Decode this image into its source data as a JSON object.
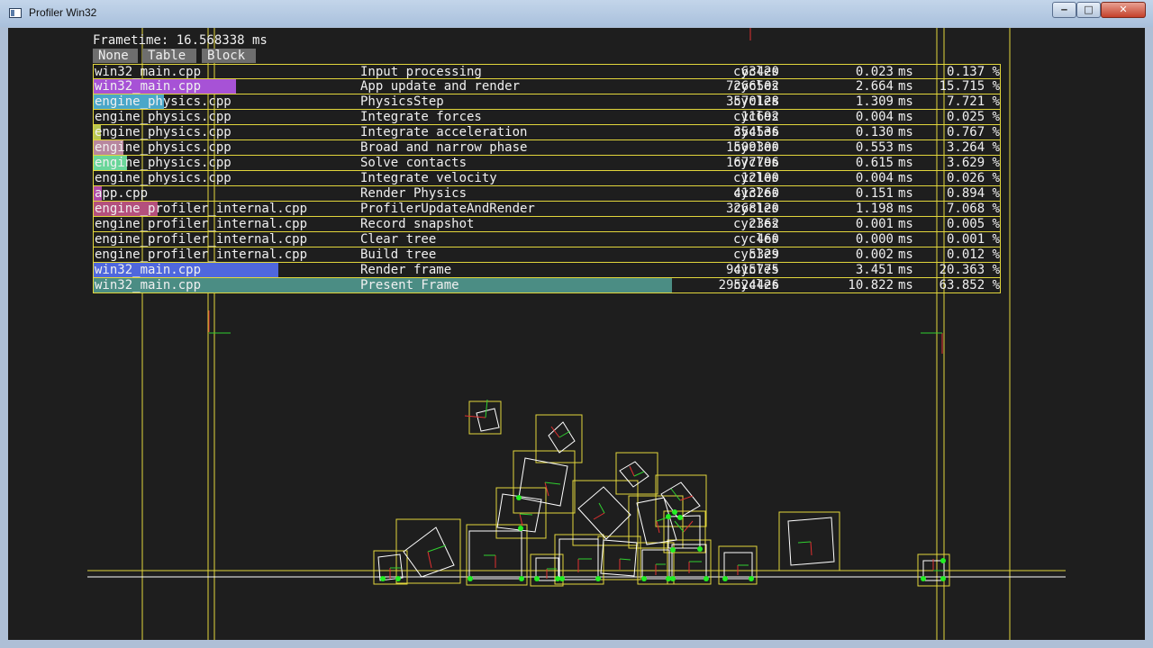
{
  "window": {
    "title": "Profiler Win32",
    "minimize_glyph": "‒",
    "maximize_glyph": "□",
    "close_glyph": "✕"
  },
  "profiler": {
    "frametime": "Frametime: 16.568338 ms",
    "modes": [
      "None",
      "Table",
      "Block"
    ],
    "rows": [
      {
        "file": "win32_main.cpp",
        "name": "Input processing",
        "cycles": "63420",
        "unit": "cycles",
        "ms": "0.023",
        "ms_unit": "ms",
        "percent": "0.137 %",
        "fraction": 0.00137,
        "color": ""
      },
      {
        "file": "win32_main.cpp",
        "name": "App update and render",
        "cycles": "7266502",
        "unit": "cycles",
        "ms": "2.664",
        "ms_unit": "ms",
        "percent": "15.715 %",
        "fraction": 0.15715,
        "color": "#a752d6"
      },
      {
        "file": "engine_physics.cpp",
        "name": "PhysicsStep",
        "cycles": "3570128",
        "unit": "cycles",
        "ms": "1.309",
        "ms_unit": "ms",
        "percent": "7.721 %",
        "fraction": 0.07721,
        "color": "#4aa7c9"
      },
      {
        "file": "engine_physics.cpp",
        "name": "Integrate forces",
        "cycles": "11692",
        "unit": "cycles",
        "ms": "0.004",
        "ms_unit": "ms",
        "percent": "0.025 %",
        "fraction": 0.00025,
        "color": ""
      },
      {
        "file": "engine_physics.cpp",
        "name": "Integrate acceleration",
        "cycles": "354536",
        "unit": "cycles",
        "ms": "0.130",
        "ms_unit": "ms",
        "percent": "0.767 %",
        "fraction": 0.00767,
        "color": "#b9c752"
      },
      {
        "file": "engine_physics.cpp",
        "name": "Broad and narrow phase",
        "cycles": "1509300",
        "unit": "cycles",
        "ms": "0.553",
        "ms_unit": "ms",
        "percent": "3.264 %",
        "fraction": 0.03264,
        "color": "#b8879f"
      },
      {
        "file": "engine_physics.cpp",
        "name": "Solve contacts",
        "cycles": "1677796",
        "unit": "cycles",
        "ms": "0.615",
        "ms_unit": "ms",
        "percent": "3.629 %",
        "fraction": 0.03629,
        "color": "#6ad69a"
      },
      {
        "file": "engine_physics.cpp",
        "name": "Integrate velocity",
        "cycles": "12100",
        "unit": "cycles",
        "ms": "0.004",
        "ms_unit": "ms",
        "percent": "0.026 %",
        "fraction": 0.00026,
        "color": ""
      },
      {
        "file": "app.cpp",
        "name": "Render Physics",
        "cycles": "413260",
        "unit": "cycles",
        "ms": "0.151",
        "ms_unit": "ms",
        "percent": "0.894 %",
        "fraction": 0.00894,
        "color": "#b04aa6"
      },
      {
        "file": "engine_profiler_internal.cpp",
        "name": "ProfilerUpdateAndRender",
        "cycles": "3268120",
        "unit": "cycles",
        "ms": "1.198",
        "ms_unit": "ms",
        "percent": "7.068 %",
        "fraction": 0.07068,
        "color": "#b4507d"
      },
      {
        "file": "engine_profiler_internal.cpp",
        "name": "Record snapshot",
        "cycles": "2362",
        "unit": "cycles",
        "ms": "0.001",
        "ms_unit": "ms",
        "percent": "0.005 %",
        "fraction": 5e-05,
        "color": ""
      },
      {
        "file": "engine_profiler_internal.cpp",
        "name": "Clear tree",
        "cycles": "460",
        "unit": "cycles",
        "ms": "0.000",
        "ms_unit": "ms",
        "percent": "0.001 %",
        "fraction": 1e-05,
        "color": ""
      },
      {
        "file": "engine_profiler_internal.cpp",
        "name": "Build tree",
        "cycles": "5329",
        "unit": "cycles",
        "ms": "0.002",
        "ms_unit": "ms",
        "percent": "0.012 %",
        "fraction": 0.00012,
        "color": ""
      },
      {
        "file": "win32_main.cpp",
        "name": "Render frame",
        "cycles": "9415775",
        "unit": "cycles",
        "ms": "3.451",
        "ms_unit": "ms",
        "percent": "20.363 %",
        "fraction": 0.20363,
        "color": "#4f67dd"
      },
      {
        "file": "win32_main.cpp",
        "name": "Present Frame",
        "cycles": "29524426",
        "unit": "cycles",
        "ms": "10.822",
        "ms_unit": "ms",
        "percent": "63.852 %",
        "fraction": 0.63852,
        "color": "#4b8d84"
      }
    ]
  },
  "colors": {
    "bounds": "#e2d63c",
    "body": "#ffffff",
    "axis_x": "#e03030",
    "axis_y": "#30d030",
    "contact": "#22ee22"
  }
}
